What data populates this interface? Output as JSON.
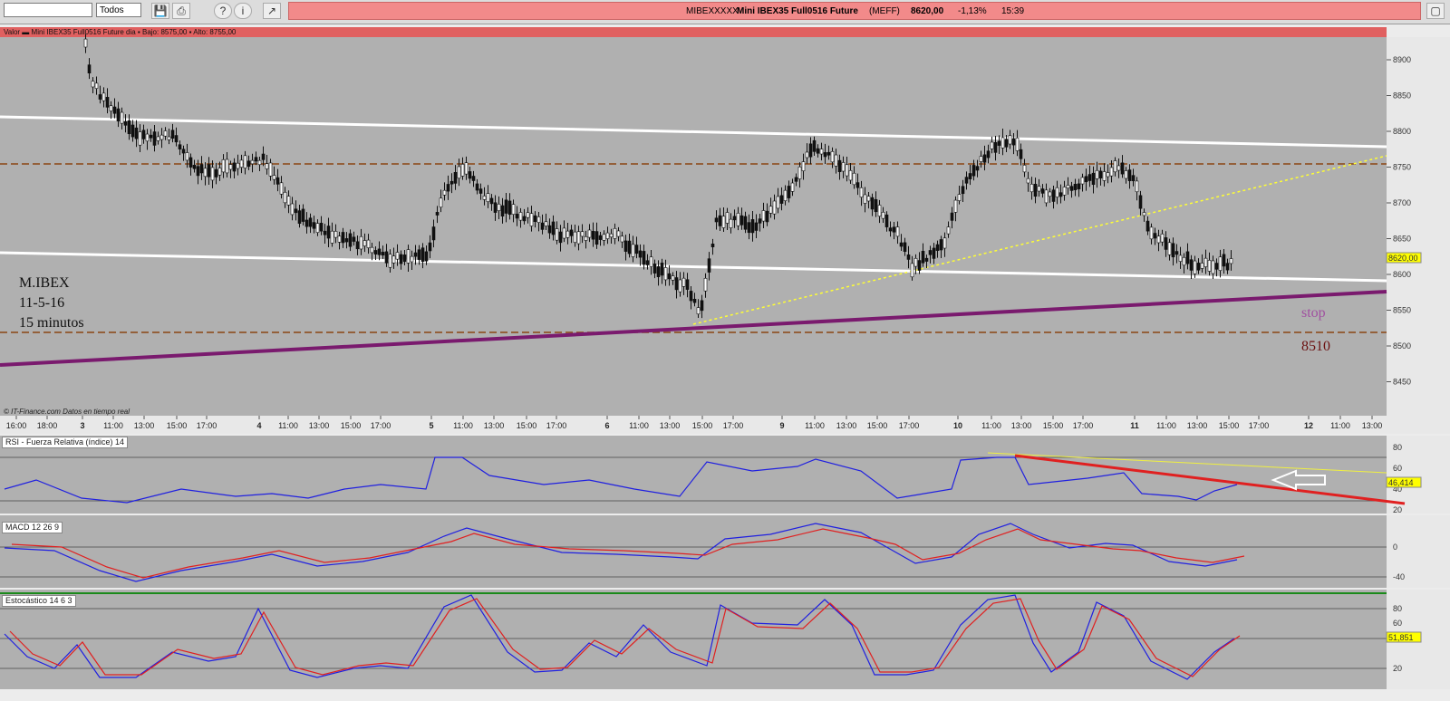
{
  "toolbar": {
    "filter_value": "Todos",
    "icons": [
      "save-icon",
      "print-icon",
      "help-icon",
      "info-icon",
      "chart-icon"
    ]
  },
  "quote": {
    "code": "MIBEXXXXX",
    "name": "Mini IBEX35 Full0516 Future",
    "market": "(MEFF)",
    "price": "8620,00",
    "change": "-1,13%",
    "time": "15:39"
  },
  "price_panel": {
    "header": "Valor  ▬ Mini IBEX35 Full0516 Future  dia ▪ Bajo: 8575,00 ▪ Alto: 8755,00",
    "source": "© IT-Finance.com  Datos en tiempo real",
    "y_ticks": [
      "8900",
      "8850",
      "8800",
      "8750",
      "8700",
      "8650",
      "8600",
      "8550",
      "8500",
      "8450"
    ],
    "last_price_tag": "8620,00",
    "x_labels": [
      "16:00",
      "18:00",
      "3",
      "11:00",
      "13:00",
      "15:00",
      "17:00",
      "4",
      "11:00",
      "13:00",
      "15:00",
      "17:00",
      "5",
      "11:00",
      "13:00",
      "15:00",
      "17:00",
      "6",
      "11:00",
      "13:00",
      "15:00",
      "17:00",
      "9",
      "11:00",
      "13:00",
      "15:00",
      "17:00",
      "10",
      "11:00",
      "13:00",
      "15:00",
      "17:00",
      "11",
      "11:00",
      "13:00",
      "15:00",
      "17:00",
      "12",
      "11:00",
      "13:00"
    ],
    "annotation": {
      "line1": "M.IBEX",
      "line2": "11-5-16",
      "line3": "15 minutos"
    },
    "stop_label": "stop",
    "stop_level": "8510"
  },
  "rsi_panel": {
    "label": "RSI - Fuerza Relativa (índice) 14",
    "y_ticks": [
      "80",
      "60",
      "40",
      "20"
    ],
    "value_tag": "46,414"
  },
  "macd_panel": {
    "label": "MACD 12 26 9",
    "y_ticks": [
      "0",
      "-40"
    ]
  },
  "stoch_panel": {
    "label": "Estocástico 14 6 3",
    "y_ticks": [
      "80",
      "60",
      "40",
      "20"
    ],
    "value_tag": "51,851"
  },
  "colors": {
    "chart_bg": "#b0b0b0",
    "quote_bg": "#f28a8a",
    "channel": "#ffffff",
    "support": "#7a1a6e",
    "dashed": "#8b4513",
    "trend_dotted": "#ffff33",
    "rsi": "#2020e0",
    "signal": "#e02020"
  }
}
